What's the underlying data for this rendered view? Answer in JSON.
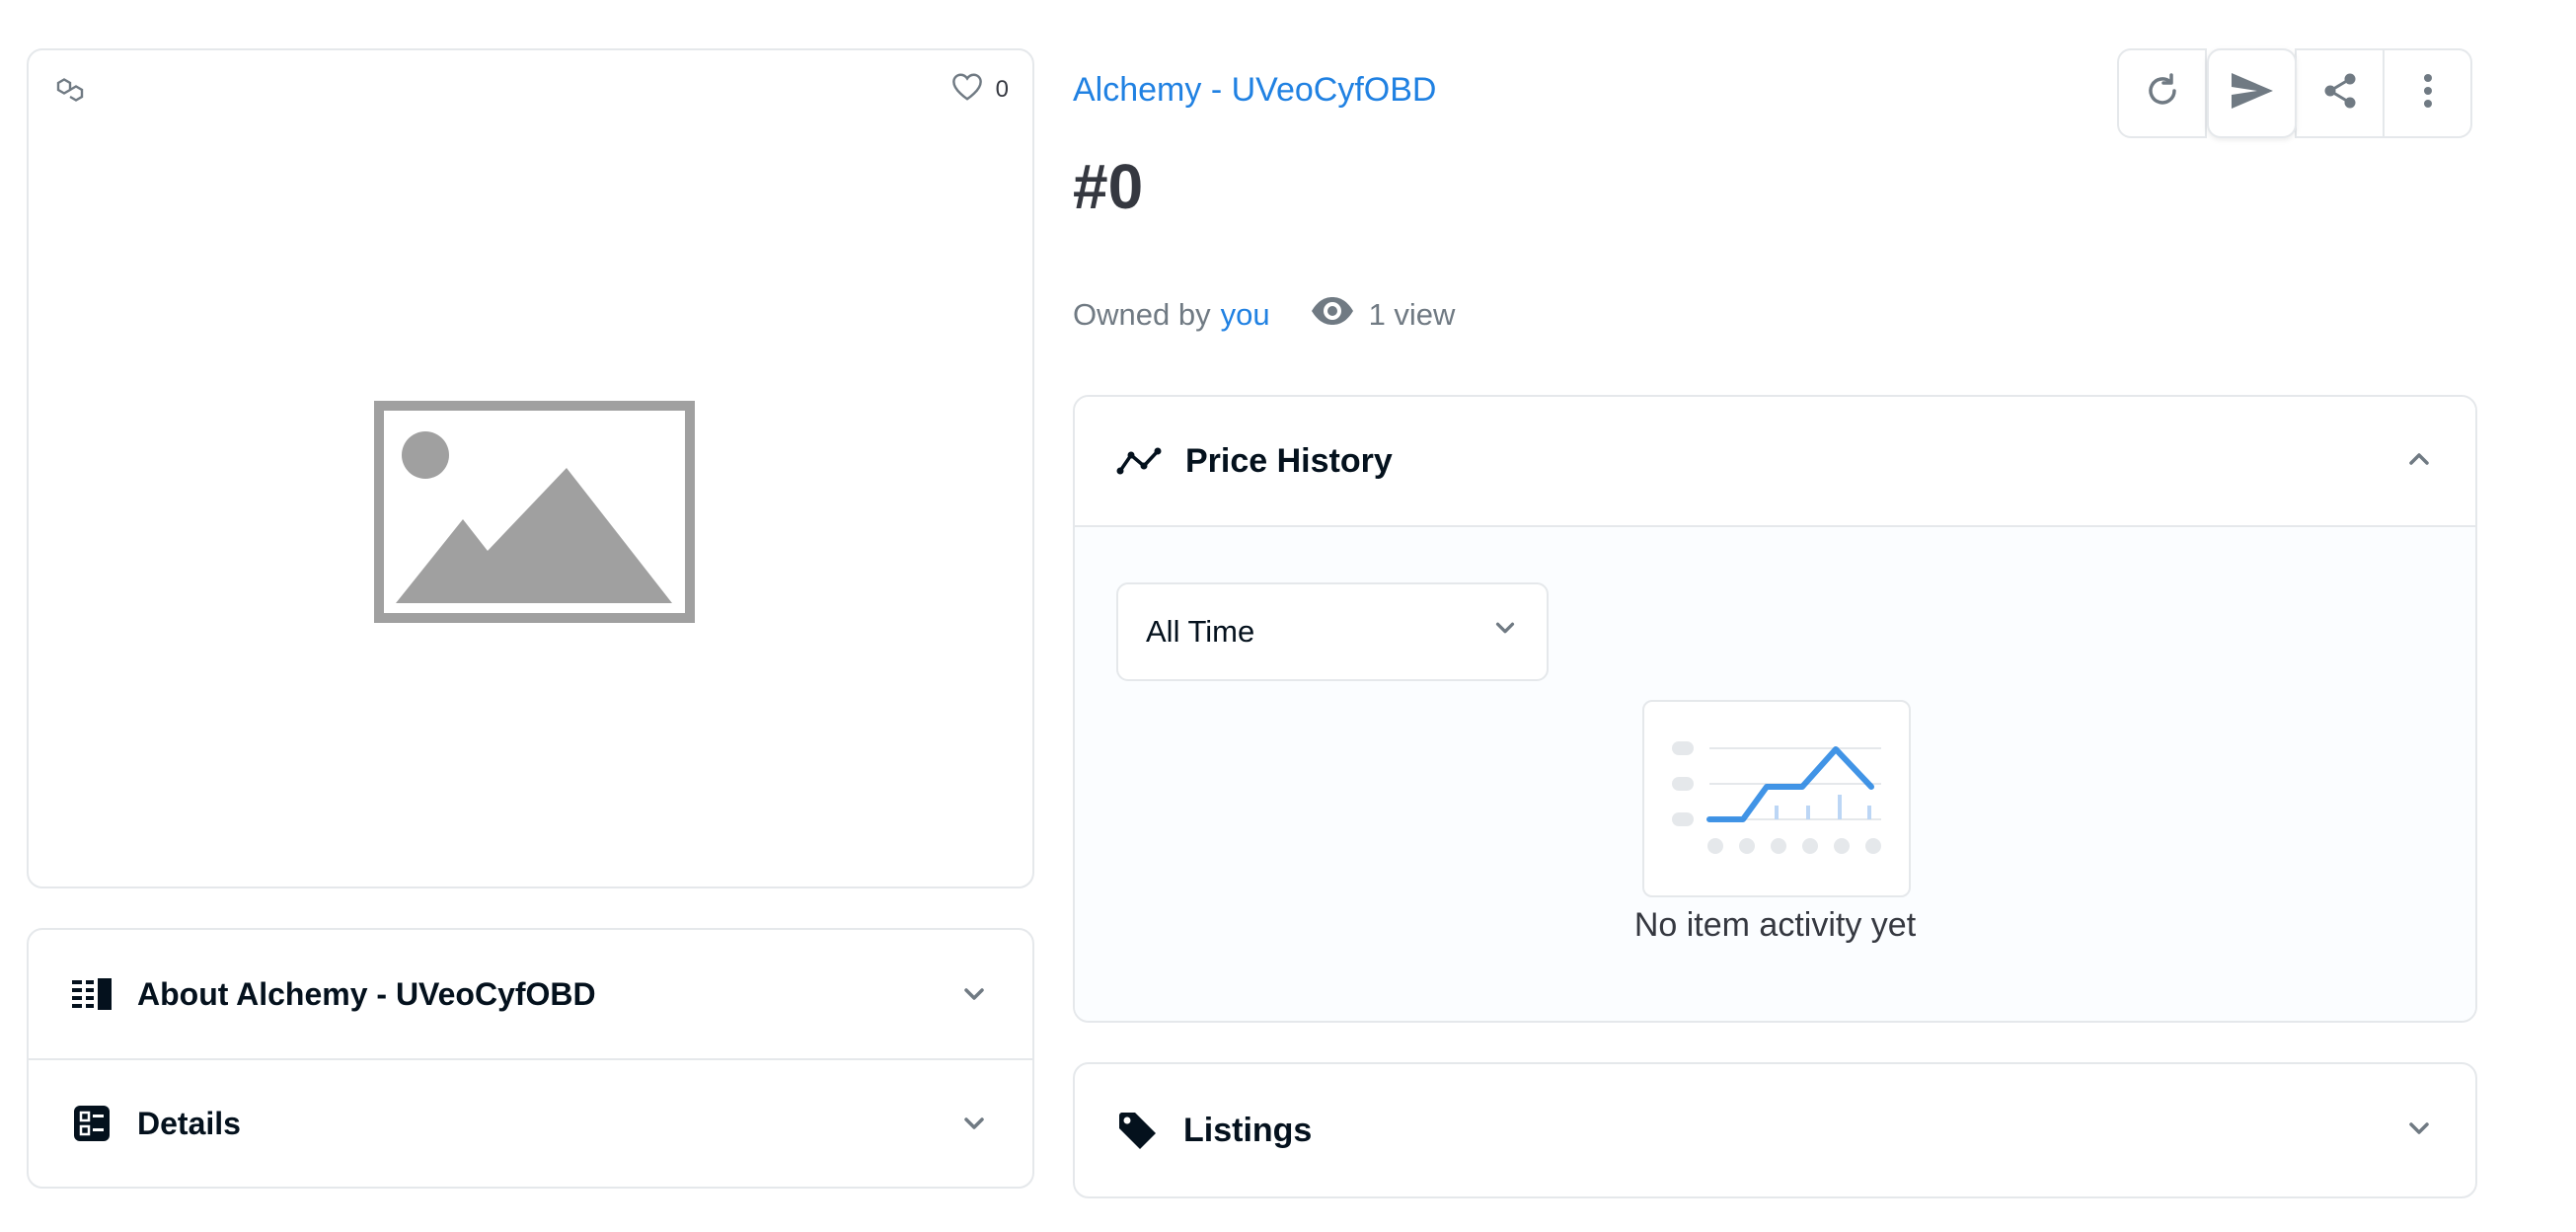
{
  "media": {
    "chain_icon": "polygon-icon",
    "favorite_icon": "heart-icon",
    "favorite_count": "0",
    "image_icon": "image-placeholder-icon"
  },
  "about": {
    "title": "About Alchemy - UVeoCyfOBD",
    "icon": "description-icon"
  },
  "details": {
    "title": "Details",
    "icon": "details-list-icon"
  },
  "header": {
    "collection_name": "Alchemy - UVeoCyfOBD",
    "token_title": "#0",
    "owned_by_label": "Owned by",
    "owner": "you",
    "views": "1 view",
    "actions": [
      "refresh-icon",
      "send-icon",
      "share-icon",
      "more-vert-icon"
    ]
  },
  "price_history": {
    "title": "Price History",
    "range_selected": "All Time",
    "empty_text": "No item activity yet",
    "accent_color": "#2081e2"
  },
  "listings": {
    "title": "Listings",
    "icon": "tag-icon"
  }
}
